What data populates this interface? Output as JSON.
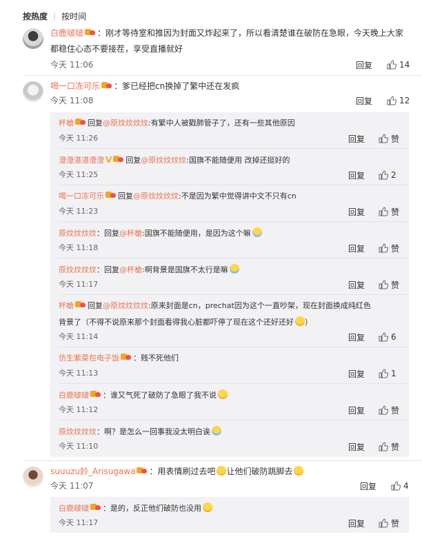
{
  "tabs": {
    "hot": "按热度",
    "time": "按时间"
  },
  "labels": {
    "reply": "回复",
    "like": "赞",
    "reply_prefix": "回复",
    "mention_at": "@"
  },
  "comments": [
    {
      "user": "白鹿啵啵",
      "text_line1": "：刚才等待室和推因为封面又炸起来了，所以看清楚谁在破防在急眼，今天晚上大家",
      "text_line2": "都稳住心态不要接茬，享受直播就好",
      "time": "今天 11:06",
      "likes": "14"
    },
    {
      "user": "喝一口冻可乐",
      "text_line1": "：爹已经把cn换掉了繁中还在发疯",
      "time": "今天 11:08",
      "likes": "12",
      "replies": [
        {
          "user": "杯槍",
          "target": "原炆炆炆炆",
          "text": ":有繁中人被戳肺管子了，还有一些其他原因",
          "time": "今天 11:26",
          "likes": "赞"
        },
        {
          "user": "澄澄湛湛澄澄",
          "target": "原炆炆炆炆",
          "text": ":国旗不能随便用 改掉还挺好的",
          "time": "今天 11:25",
          "likes": "2"
        },
        {
          "user": "喝一口冻可乐",
          "target": "原炆炆炆炆",
          "text": ":不是因为繁中觉得讲中文不只有cn",
          "time": "今天 11:23",
          "likes": "赞"
        },
        {
          "user": "原炆炆炆炆",
          "target": "杯槍",
          "text": ":国旗不能随便用，是因为这个嘛",
          "time": "今天 11:18",
          "likes": "赞"
        },
        {
          "user": "原炆炆炆炆",
          "target": "杯槍",
          "text": ":啊背景是国旗不太行是嘛",
          "time": "今天 11:17",
          "likes": "赞"
        },
        {
          "user": "杯槍",
          "target": "原炆炆炆炆",
          "text": ":原来封面是cn，prechat因为这个一直吵架，现在封面换成纯红色",
          "text_line2": "背景了（不得不说原来那个封面看得我心脏都吓停了现在这个还好还好",
          "text_line2_end": "）",
          "time": "今天 11:14",
          "likes": "6"
        },
        {
          "user": "仿生紫菜包电子饭",
          "text": "：贱不死他们",
          "time": "今天 11:13",
          "likes": "1"
        },
        {
          "user": "白鹿啵啵",
          "text": "：谁又气死了破防了急眼了我不说",
          "time": "今天 11:12",
          "likes": "赞"
        },
        {
          "user": "原炆炆炆炆",
          "text": "：啊？是怎么一回事我没太明白诶",
          "time": "今天 11:10",
          "likes": "赞"
        }
      ]
    },
    {
      "user": "suuuzu鈴_Arisugawa",
      "text_line1": "：用表情刷过去吧",
      "text_mid": "让他们破防跳脚去",
      "time": "今天 11:07",
      "likes": "4",
      "replies": [
        {
          "user": "白鹿啵啵",
          "text": "：是的，反正他们破防也没用",
          "time": "今天 11:17",
          "likes": "赞"
        }
      ]
    }
  ]
}
